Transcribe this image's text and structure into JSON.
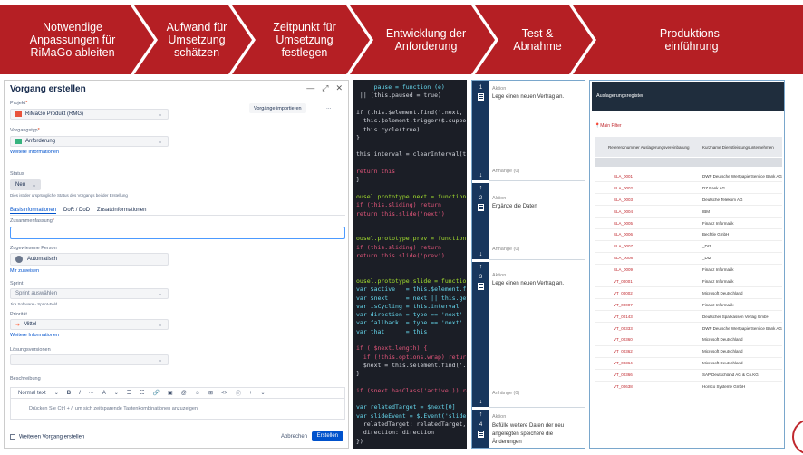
{
  "process_steps": [
    "Notwendige\nAnpassungen für\nRiMaGo ableiten",
    "Aufwand für\nUmsetzung\nschätzen",
    "Zeitpunkt für\nUmsetzung\nfestlegen",
    "Entwicklung der\nAnforderung",
    "Test &\nAbnahme",
    "Produktions-\neinführung"
  ],
  "colors": {
    "accent_red": "#b51f24",
    "link_blue": "#0052cc",
    "code_bg": "#1b1e26",
    "lane_navy": "#17365d"
  },
  "jira": {
    "title": "Vorgang erstellen",
    "window_controls": [
      "—",
      "⤢",
      "✕"
    ],
    "project_label": "Projekt",
    "project_value": "RiMaGo Produkt (RMG)",
    "import_button": "Vorgänge importieren",
    "more_button": "···",
    "type_label": "Vorgangstyp",
    "type_value": "Anforderung",
    "more_info_1": "Weitere Informationen",
    "status_label": "Status",
    "status_value": "Neu",
    "status_hint": "Dies ist der ursprüngliche Status des Vorgangs bei der Erstellung",
    "tabs": [
      "Basisinformationen",
      "DoR / DoD",
      "Zusatzinformationen"
    ],
    "summary_label": "Zusammenfassung",
    "assignee_label": "Zugewiesene Person",
    "assignee_value": "Automatisch",
    "assign_me": "Mir zuweisen",
    "sprint_label": "Sprint",
    "sprint_placeholder": "Sprint auswählen",
    "sprint_hint": "Jira Software - Sprint-Feld",
    "priority_label": "Priorität",
    "priority_value": "Mittel",
    "more_info_2": "Weitere Informationen",
    "solution_label": "Lösungsversionen",
    "desc_label": "Beschreibung",
    "toolbar": [
      "Normal text",
      "⌄",
      "B",
      "I",
      "···",
      "A",
      "⌄",
      "☰",
      "☷",
      "🔗",
      "▣",
      "@",
      "☺",
      "⊞",
      "<>",
      "ⓘ",
      "+",
      "⌄"
    ],
    "editor_placeholder": "Drücken Sie Ctrl + /, um sich zeitsparende Tastenkombinationen anzuzeigen.",
    "another_checkbox": "Weiteren Vorgang erstellen",
    "cancel": "Abbrechen",
    "create": "Erstellen"
  },
  "code_lines": [
    {
      "t": "    .pause = function (e)",
      "c": "fn"
    },
    {
      "t": " || (this.paused = true)",
      "c": ""
    },
    {
      "t": "",
      "c": ""
    },
    {
      "t": "if (this.$element.find('.next, .prev')",
      "c": ""
    },
    {
      "t": "  this.$element.trigger($.support.tra",
      "c": ""
    },
    {
      "t": "  this.cycle(true)",
      "c": ""
    },
    {
      "t": "}",
      "c": ""
    },
    {
      "t": "",
      "c": ""
    },
    {
      "t": "this.interval = clearInterval(this.in",
      "c": ""
    },
    {
      "t": "",
      "c": ""
    },
    {
      "t": "return this",
      "c": "kw"
    },
    {
      "t": "}",
      "c": ""
    },
    {
      "t": "",
      "c": ""
    },
    {
      "t": "ousel.prototype.next = function () {",
      "c": "gr"
    },
    {
      "t": "if (this.sliding) return",
      "c": "kw"
    },
    {
      "t": "return this.slide('next')",
      "c": "kw"
    },
    {
      "t": "",
      "c": ""
    },
    {
      "t": "",
      "c": ""
    },
    {
      "t": "ousel.prototype.prev = function () {",
      "c": "gr"
    },
    {
      "t": "if (this.sliding) return",
      "c": "kw"
    },
    {
      "t": "return this.slide('prev')",
      "c": "kw"
    },
    {
      "t": "",
      "c": ""
    },
    {
      "t": "",
      "c": ""
    },
    {
      "t": "ousel.prototype.slide = function (ty",
      "c": "gr"
    },
    {
      "t": "var $active   = this.$element.find('.",
      "c": "fn"
    },
    {
      "t": "var $next     = next || this.getItem",
      "c": "fn"
    },
    {
      "t": "var isCycling = this.interval",
      "c": "fn"
    },
    {
      "t": "var direction = type == 'next' ? 'lef",
      "c": "fn"
    },
    {
      "t": "var fallback  = type == 'next' ? 'fir",
      "c": "fn"
    },
    {
      "t": "var that      = this",
      "c": "fn"
    },
    {
      "t": "",
      "c": ""
    },
    {
      "t": "if (!$next.length) {",
      "c": "kw"
    },
    {
      "t": "  if (!this.options.wrap) return",
      "c": "kw"
    },
    {
      "t": "  $next = this.$element.find('.item')",
      "c": ""
    },
    {
      "t": "}",
      "c": ""
    },
    {
      "t": "",
      "c": ""
    },
    {
      "t": "if ($next.hasClass('active')) return",
      "c": "kw"
    },
    {
      "t": "",
      "c": ""
    },
    {
      "t": "var relatedTarget = $next[0]",
      "c": "fn"
    },
    {
      "t": "var slideEvent = $.Event('slide.bs.ca",
      "c": "fn"
    },
    {
      "t": "  relatedTarget: relatedTarget,",
      "c": ""
    },
    {
      "t": "  direction: direction",
      "c": ""
    },
    {
      "t": "})",
      "c": ""
    }
  ],
  "workflow": [
    {
      "num": "1",
      "action": "Aktion",
      "text": "Lege einen neuen Vertrag an.",
      "attachments": "Anhänge (0)"
    },
    {
      "num": "2",
      "action": "Aktion",
      "text": "Ergänze die Daten",
      "attachments": "Anhänge (0)"
    },
    {
      "num": "3",
      "action": "Aktion",
      "text": "Lege einen neuen Vertrag an.",
      "attachments": "Anhänge (0)"
    },
    {
      "num": "4",
      "action": "Aktion",
      "text": "Befülle weitere Daten der neu angelegten speichere die Änderungen",
      "attachments": ""
    }
  ],
  "register": {
    "title": "Auslagerungsregister",
    "filter": "Main Filter",
    "col1": "Referenznummer Auslagerungsvereinbarung",
    "col2": "Kurzname Dienstleistungsunternehmen",
    "rows": [
      [
        "SLA_0001",
        "DWP Deutsche WertpapierService Bank AG"
      ],
      [
        "SLA_0002",
        "DZ Bank AG"
      ],
      [
        "SLA_0003",
        "Deutsche Telekom AG"
      ],
      [
        "SLA_0004",
        "IBM"
      ],
      [
        "SLA_0005",
        "Finanz Informatik"
      ],
      [
        "SLA_0006",
        "Bechtle GmbH"
      ],
      [
        "SLA_0007",
        "_DIZ"
      ],
      [
        "SLA_0008",
        "_DIZ"
      ],
      [
        "SLA_0009",
        "Finanz Informatik"
      ],
      [
        "VT_00001",
        "Finanz Informatik"
      ],
      [
        "VT_00002",
        "Microsoft Deutschland"
      ],
      [
        "VT_00007",
        "Finanz Informatik"
      ],
      [
        "VT_00143",
        "Deutscher Sparkassen Verlag GmbH"
      ],
      [
        "VT_00333",
        "DWP Deutsche WertpapierService Bank AG"
      ],
      [
        "VT_00360",
        "Microsoft Deutschland"
      ],
      [
        "VT_00362",
        "Microsoft Deutschland"
      ],
      [
        "VT_00364",
        "Microsoft Deutschland"
      ],
      [
        "VT_00366",
        "SAP Deutschland AG & Co.KG"
      ],
      [
        "VT_00638",
        "Horsco Systeme GmbH"
      ]
    ]
  }
}
